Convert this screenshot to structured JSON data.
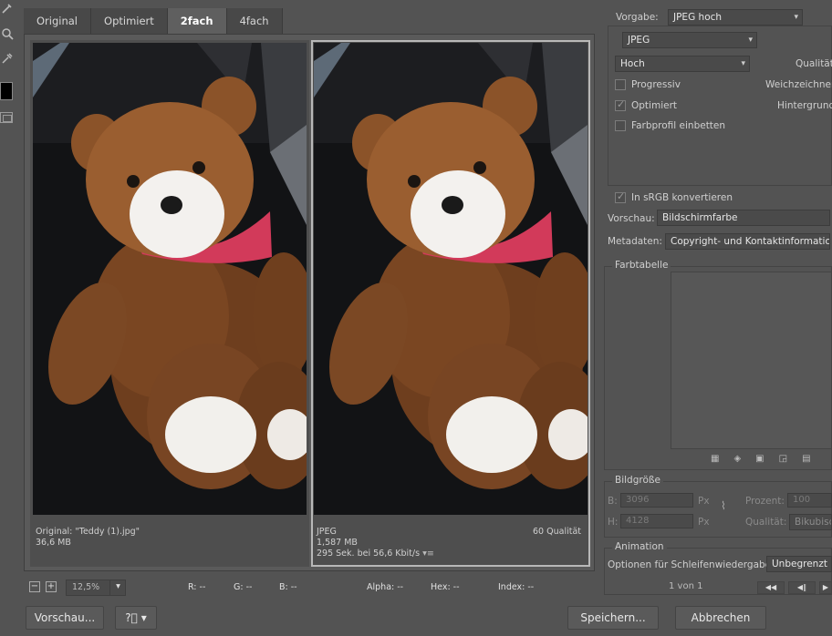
{
  "tabs": [
    "Original",
    "Optimiert",
    "2fach",
    "4fach"
  ],
  "active_tab": "2fach",
  "pane_original": {
    "line1": "Original: \"Teddy (1).jpg\"",
    "line2": "36,6 MB"
  },
  "pane_optimized": {
    "format": "JPEG",
    "size": "1,587 MB",
    "time": "295 Sek. bei 56,6 Kbit/s",
    "quality": "60 Qualität"
  },
  "statusbar": {
    "minus": "−",
    "plus": "+",
    "zoom": "12,5%",
    "r": "R: --",
    "g": "G: --",
    "b": "B: --",
    "alpha": "Alpha: --",
    "hex": "Hex: --",
    "index": "Index: --"
  },
  "footer": {
    "preview": "Vorschau...",
    "save": "Speichern...",
    "cancel": "Abbrechen"
  },
  "settings": {
    "preset_label": "Vorgabe:",
    "preset_value": "JPEG hoch",
    "format_value": "JPEG",
    "quality_preset": "Hoch",
    "quality_label": "Qualität",
    "progressive": "Progressiv",
    "blur_label": "Weichzeichnen",
    "optimized": "Optimiert",
    "matte_label": "Hintergrund",
    "embed_profile": "Farbprofil einbetten",
    "srgb": "In sRGB konvertieren",
    "preview_label": "Vorschau:",
    "preview_value": "Bildschirmfarbe",
    "metadata_label": "Metadaten:",
    "metadata_value": "Copyright- und Kontaktinformationen",
    "color_table": "Farbtabelle"
  },
  "image_size": {
    "title": "Bildgröße",
    "b_label": "B:",
    "b_value": "3096",
    "h_label": "H:",
    "h_value": "4128",
    "unit": "Px",
    "percent_label": "Prozent:",
    "percent_value": "100",
    "quality_label": "Qualität:",
    "quality_value": "Bikubisch"
  },
  "animation": {
    "title": "Animation",
    "loop_label": "Optionen für Schleifenwiedergabe:",
    "loop_value": "Unbegrenzt",
    "frame": "1 von 1"
  },
  "icons": [
    "eyedropper-icon",
    "zoom-icon",
    "color-picker-icon",
    "chevron-down-icon",
    "help-icon",
    "link-icon"
  ]
}
